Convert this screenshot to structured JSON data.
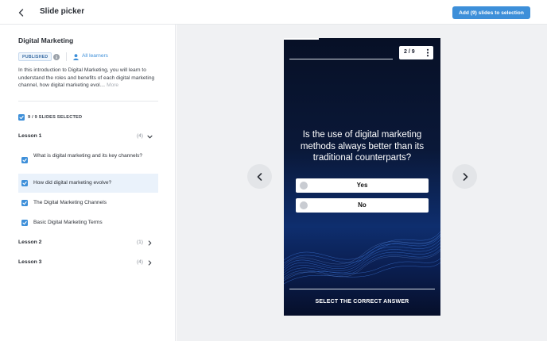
{
  "header": {
    "title": "Slide picker",
    "add_button": "Add (9) slides to selection"
  },
  "course": {
    "title": "Digital Marketing",
    "status": "PUBLISHED",
    "audience": "All learners",
    "description": "In this introduction to Digital Marketing, you will learn to understand the roles and benefits of each digital marketing channel, how digital marketing evol…",
    "more": "More"
  },
  "selection": {
    "label": "9 / 9 SLIDES SELECTED"
  },
  "lessons": [
    {
      "name": "Lesson 1",
      "count": "(4)",
      "expanded": true,
      "slides": [
        {
          "title": "What is digital marketing and its key channels?",
          "checked": true
        },
        {
          "title": "How did digital marketing evolve?",
          "checked": true,
          "active": true
        },
        {
          "title": "The Digital Marketing Channels",
          "checked": true
        },
        {
          "title": "Basic Digital Marketing Terms",
          "checked": true
        }
      ]
    },
    {
      "name": "Lesson 2",
      "count": "(1)",
      "expanded": false
    },
    {
      "name": "Lesson 3",
      "count": "(4)",
      "expanded": false
    }
  ],
  "preview": {
    "counter": "2 / 9",
    "question": "Is the use of digital marketing methods always better than its traditional counterparts?",
    "answers": [
      "Yes",
      "No"
    ],
    "instruction": "SELECT THE CORRECT ANSWER"
  },
  "colors": {
    "accent": "#3d8fd9",
    "slide_background": "#0a1838"
  }
}
